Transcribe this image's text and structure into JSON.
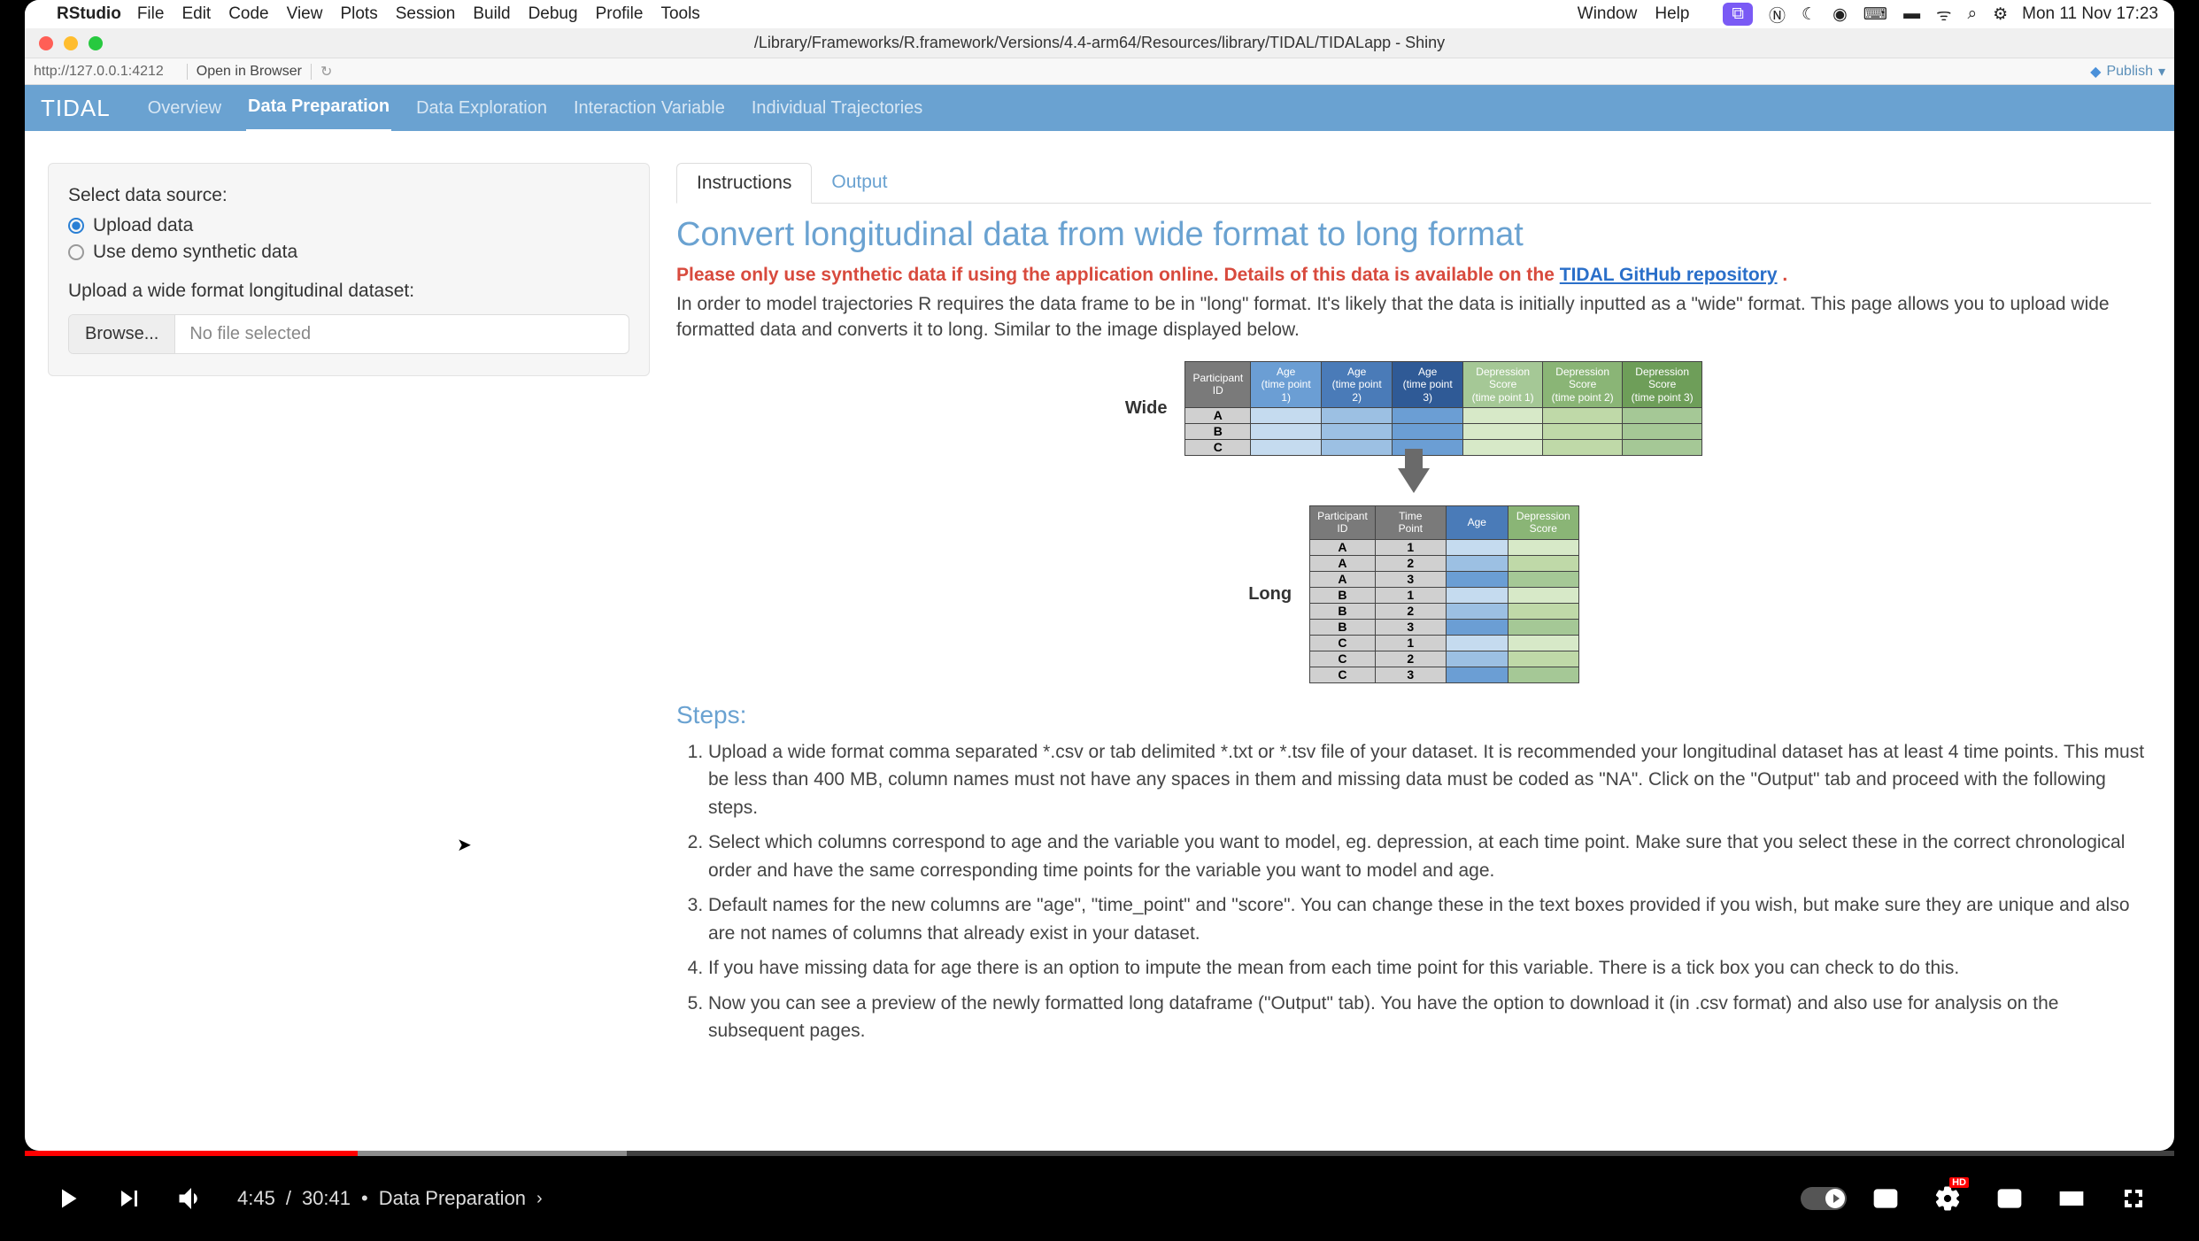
{
  "mac": {
    "app_name": "RStudio",
    "menus": [
      "File",
      "Edit",
      "Code",
      "View",
      "Plots",
      "Session",
      "Build",
      "Debug",
      "Profile",
      "Tools"
    ],
    "right_menus": [
      "Window",
      "Help"
    ],
    "datetime": "Mon 11 Nov  17:23"
  },
  "window": {
    "title": "/Library/Frameworks/R.framework/Versions/4.4-arm64/Resources/library/TIDAL/TIDALapp - Shiny",
    "url": "http://127.0.0.1:4212",
    "open_browser": "Open in Browser",
    "publish": "Publish"
  },
  "nav": {
    "brand": "TIDAL",
    "links": [
      "Overview",
      "Data Preparation",
      "Data Exploration",
      "Interaction Variable",
      "Individual Trajectories"
    ],
    "active_index": 1
  },
  "sidebar": {
    "source_label": "Select data source:",
    "radio_options": [
      "Upload data",
      "Use demo synthetic data"
    ],
    "radio_selected": 0,
    "upload_label": "Upload a wide format longitudinal dataset:",
    "browse_label": "Browse...",
    "file_status": "No file selected"
  },
  "tabs": {
    "items": [
      "Instructions",
      "Output"
    ],
    "active_index": 0
  },
  "content": {
    "heading": "Convert longitudinal data from wide format to long format",
    "warn_prefix": "Please only use synthetic data if using the application online. Details of this data is available on the ",
    "warn_link": "TIDAL GitHub repository",
    "warn_suffix": " .",
    "desc": "In order to model trajectories R requires the data frame to be in \"long\" format. It's likely that the data is initially inputted as a \"wide\" format. This page allows you to upload wide formatted data and converts it to long. Similar to the image displayed below.",
    "wide_label": "Wide",
    "long_label": "Long",
    "steps_heading": "Steps:",
    "steps": [
      "Upload a wide format comma separated *.csv or tab delimited *.txt or *.tsv file of your dataset. It is recommended your longitudinal dataset has at least 4 time points. This must be less than 400 MB, column names must not have any spaces in them and missing data must be coded as \"NA\". Click on the \"Output\" tab and proceed with the following steps.",
      "Select which columns correspond to age and the variable you want to model, eg. depression, at each time point. Make sure that you select these in the correct chronological order and have the same corresponding time points for the variable you want to model and age.",
      "Default names for the new columns are \"age\", \"time_point\" and \"score\". You can change these in the text boxes provided if you wish, but make sure they are unique and also are not names of columns that already exist in your dataset.",
      "If you have missing data for age there is an option to impute the mean from each time point for this variable. There is a tick box you can check to do this.",
      "Now you can see a preview of the newly formatted long dataframe (\"Output\" tab). You have the option to download it (in .csv format) and also use for analysis on the subsequent pages."
    ]
  },
  "diagram": {
    "wide_headers": [
      "Participant ID",
      "Age (time point 1)",
      "Age (time point 2)",
      "Age (time point 3)",
      "Depression Score (time point 1)",
      "Depression Score (time point 2)",
      "Depression Score (time point 3)"
    ],
    "wide_rows": [
      [
        "A",
        "",
        "",
        "",
        "",
        "",
        ""
      ],
      [
        "B",
        "",
        "",
        "",
        "",
        "",
        ""
      ],
      [
        "C",
        "",
        "",
        "",
        "",
        "",
        ""
      ]
    ],
    "long_headers": [
      "Participant ID",
      "Time Point",
      "Age",
      "Depression Score"
    ],
    "long_rows": [
      [
        "A",
        "1",
        "",
        ""
      ],
      [
        "A",
        "2",
        "",
        ""
      ],
      [
        "A",
        "3",
        "",
        ""
      ],
      [
        "B",
        "1",
        "",
        ""
      ],
      [
        "B",
        "2",
        "",
        ""
      ],
      [
        "B",
        "3",
        "",
        ""
      ],
      [
        "C",
        "1",
        "",
        ""
      ],
      [
        "C",
        "2",
        "",
        ""
      ],
      [
        "C",
        "3",
        "",
        ""
      ]
    ]
  },
  "player": {
    "current_time": "4:45",
    "duration": "30:41",
    "chapter": "Data Preparation",
    "hd": "HD"
  }
}
